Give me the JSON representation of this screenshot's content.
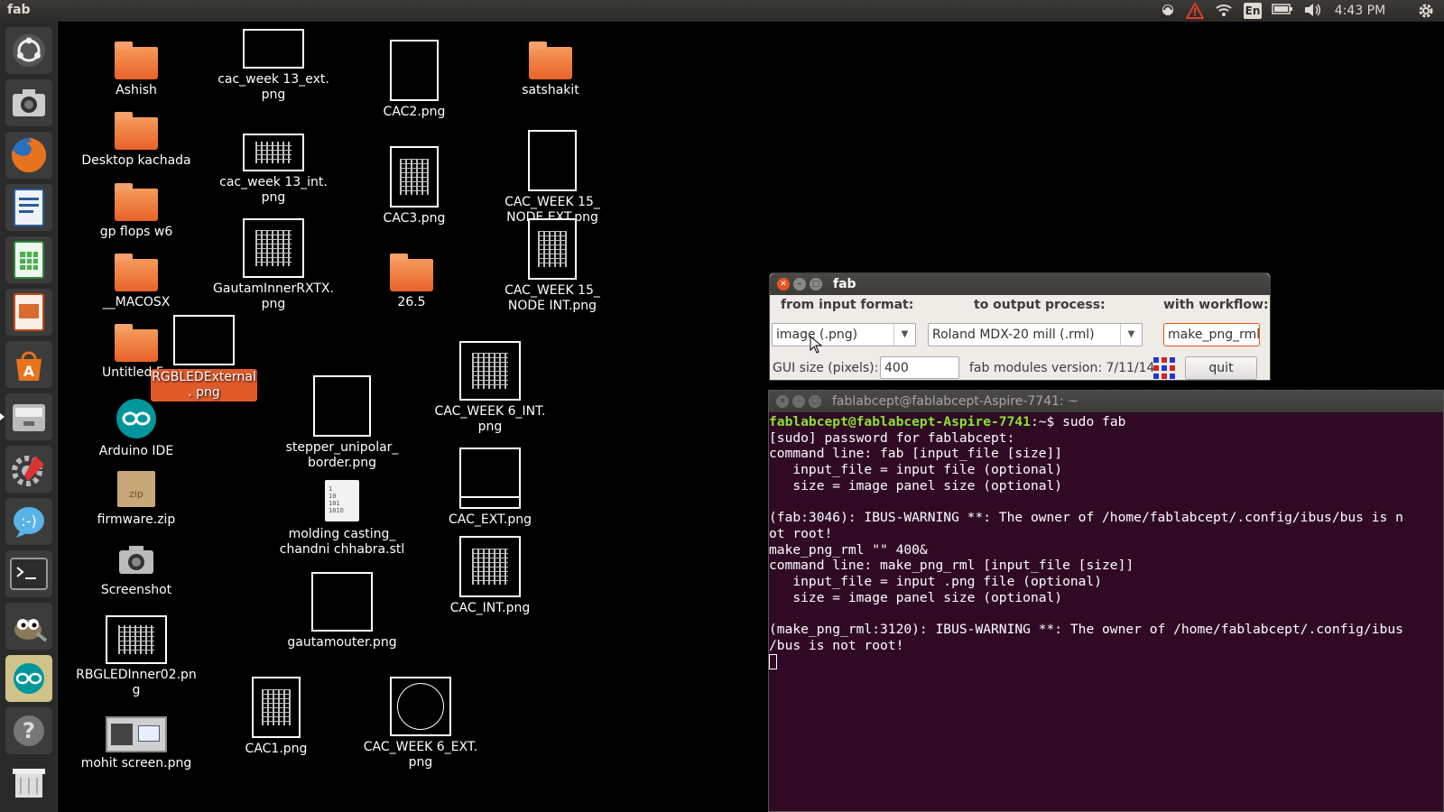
{
  "topbar": {
    "title": "fab",
    "keyboard": "En",
    "time": "4:43 PM"
  },
  "launcher": {
    "items": [
      "dash",
      "camera",
      "firefox",
      "writer",
      "calc",
      "impress",
      "software-center",
      "files",
      "settings",
      "empathy",
      "terminal",
      "gimp",
      "arduino",
      "help",
      "trash"
    ]
  },
  "desktop": {
    "icons": [
      {
        "label": "Ashish",
        "type": "folder"
      },
      {
        "label": "Desktop kachada",
        "type": "folder"
      },
      {
        "label": "gp flops w6",
        "type": "folder"
      },
      {
        "label": "__MACOSX",
        "type": "folder"
      },
      {
        "label": "Untitled Fo",
        "type": "folder"
      },
      {
        "label": "Arduino IDE",
        "type": "app"
      },
      {
        "label": "firmware.zip",
        "type": "zip"
      },
      {
        "label": "Screenshot",
        "type": "app"
      },
      {
        "label": "RBGLEDInner02.png",
        "type": "image"
      },
      {
        "label": "mohit screen.png",
        "type": "image"
      },
      {
        "label": "cac_week 13_ext. png",
        "type": "image"
      },
      {
        "label": "cac_week 13_int. png",
        "type": "image"
      },
      {
        "label": "GautamInnerRXTX. png",
        "type": "image"
      },
      {
        "label": "RGBLEDExternal. png",
        "type": "image",
        "selected": true
      },
      {
        "label": "CAC2.png",
        "type": "image"
      },
      {
        "label": "CAC3.png",
        "type": "image"
      },
      {
        "label": "26.5",
        "type": "folder"
      },
      {
        "label": "satshakit",
        "type": "folder"
      },
      {
        "label": "CAC_WEEK 15_ NODE EXT.png",
        "type": "image"
      },
      {
        "label": "CAC_WEEK 15_ NODE INT.png",
        "type": "image"
      },
      {
        "label": "stepper_unipolar_ border.png",
        "type": "image"
      },
      {
        "label": "molding casting_ chandni chhabra.stl",
        "type": "file"
      },
      {
        "label": "gautamouter.png",
        "type": "image"
      },
      {
        "label": "CAC1.png",
        "type": "image"
      },
      {
        "label": "CAC_WEEK 6_INT. png",
        "type": "image"
      },
      {
        "label": "CAC_EXT.png",
        "type": "image"
      },
      {
        "label": "CAC_INT.png",
        "type": "image"
      },
      {
        "label": "CAC_WEEK 6_EXT. png",
        "type": "image"
      }
    ]
  },
  "fab_window": {
    "title": "fab",
    "from_label": "from input format:",
    "to_label": "to output process:",
    "workflow_label": "with workflow:",
    "input_format": "image (.png)",
    "output_process": "Roland MDX-20 mill (.rml)",
    "workflow": "make_png_rml",
    "gui_size_label": "GUI size (pixels):",
    "gui_size": "400",
    "version_label": "fab modules version: 7/11/14",
    "quit_label": "quit"
  },
  "terminal": {
    "title": "fablabcept@fablabcept-Aspire-7741: ~",
    "prompt_user": "fablabcept@fablabcept-Aspire-7741",
    "prompt_rest": ":~$ sudo fab",
    "lines": [
      "[sudo] password for fablabcept:",
      "command line: fab [input_file [size]]",
      "   input_file = input file (optional)",
      "   size = image panel size (optional)",
      "",
      "(fab:3046): IBUS-WARNING **: The owner of /home/fablabcept/.config/ibus/bus is n",
      "ot root!",
      "make_png_rml \"\" 400&",
      "command line: make_png_rml [input_file [size]]",
      "   input_file = input .png file (optional)",
      "   size = image panel size (optional)",
      "",
      "(make_png_rml:3120): IBUS-WARNING **: The owner of /home/fablabcept/.config/ibus",
      "/bus is not root!"
    ]
  }
}
